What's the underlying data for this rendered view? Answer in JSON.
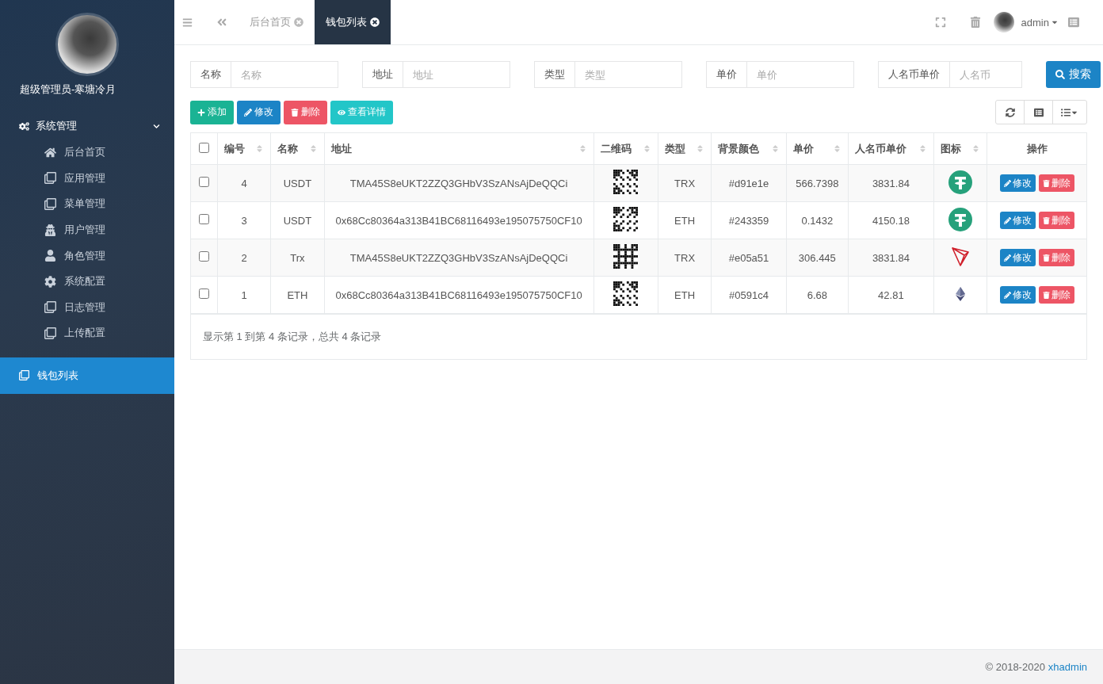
{
  "sidebar": {
    "profile_name": "超级管理员-寒塘冷月",
    "menu": [
      {
        "label": "系统管理",
        "kind": "group",
        "expanded": true,
        "selected": false,
        "children": [
          {
            "label": "后台首页",
            "kind": "home",
            "selected": false
          },
          {
            "label": "应用管理",
            "kind": "copy",
            "selected": false
          },
          {
            "label": "菜单管理",
            "kind": "copy",
            "selected": false
          },
          {
            "label": "用户管理",
            "kind": "user-secret",
            "selected": false
          },
          {
            "label": "角色管理",
            "kind": "user",
            "selected": false
          },
          {
            "label": "系统配置",
            "kind": "gear",
            "selected": false
          },
          {
            "label": "日志管理",
            "kind": "copy",
            "selected": false
          },
          {
            "label": "上传配置",
            "kind": "copy",
            "selected": false
          }
        ]
      },
      {
        "label": "钱包列表",
        "kind": "item",
        "selected": true
      }
    ]
  },
  "header": {
    "tabs": [
      {
        "label": "后台首页",
        "selected": false
      },
      {
        "label": "钱包列表",
        "selected": true
      }
    ],
    "user": "admin"
  },
  "filters": [
    {
      "label": "名称",
      "placeholder": "名称"
    },
    {
      "label": "地址",
      "placeholder": "地址"
    },
    {
      "label": "类型",
      "placeholder": "类型"
    },
    {
      "label": "单价",
      "placeholder": "单价"
    },
    {
      "label": "人名币单价",
      "placeholder": "人名币"
    }
  ],
  "search_button": "搜索",
  "actions": [
    {
      "label": "添加",
      "kind": "add"
    },
    {
      "label": "修改",
      "kind": "edit"
    },
    {
      "label": "删除",
      "kind": "delete"
    },
    {
      "label": "查看详情",
      "kind": "view"
    }
  ],
  "table": {
    "select_all": false,
    "columns": [
      {
        "label": "编号",
        "sortable": true
      },
      {
        "label": "名称",
        "sortable": true
      },
      {
        "label": "地址",
        "sortable": true
      },
      {
        "label": "二维码",
        "sortable": true
      },
      {
        "label": "类型",
        "sortable": true
      },
      {
        "label": "背景颜色",
        "sortable": true
      },
      {
        "label": "单价",
        "sortable": true
      },
      {
        "label": "人名币单价",
        "sortable": true
      },
      {
        "label": "图标",
        "sortable": true
      },
      {
        "label": "操作",
        "sortable": false
      }
    ],
    "rows": [
      {
        "checked": false,
        "id": "4",
        "name": "USDT",
        "address": "TMA45S8eUKT2ZZQ3GHbV3SzANsAjDeQQCi",
        "type": "TRX",
        "bg_color": "#d91e1e",
        "price": "566.7398",
        "cny_price": "3831.84",
        "kind": "tether",
        "edit": "修改",
        "delete": "删除"
      },
      {
        "checked": false,
        "id": "3",
        "name": "USDT",
        "address": "0x68Cc80364a313B41BC68116493e195075750CF10",
        "type": "ETH",
        "bg_color": "#243359",
        "price": "0.1432",
        "cny_price": "4150.18",
        "kind": "tether",
        "edit": "修改",
        "delete": "删除"
      },
      {
        "checked": false,
        "id": "2",
        "name": "Trx",
        "address": "TMA45S8eUKT2ZZQ3GHbV3SzANsAjDeQQCi",
        "type": "TRX",
        "bg_color": "#e05a51",
        "price": "306.445",
        "cny_price": "3831.84",
        "kind": "tron",
        "edit": "修改",
        "delete": "删除"
      },
      {
        "checked": false,
        "id": "1",
        "name": "ETH",
        "address": "0x68Cc80364a313B41BC68116493e195075750CF10",
        "type": "ETH",
        "bg_color": "#0591c4",
        "price": "6.68",
        "cny_price": "42.81",
        "kind": "ethereum",
        "edit": "修改",
        "delete": "删除"
      }
    ],
    "summary": "显示第 1 到第 4 条记录，总共 4 条记录"
  },
  "footer": {
    "copyright": "© 2018-2020",
    "link": "xhadmin"
  }
}
